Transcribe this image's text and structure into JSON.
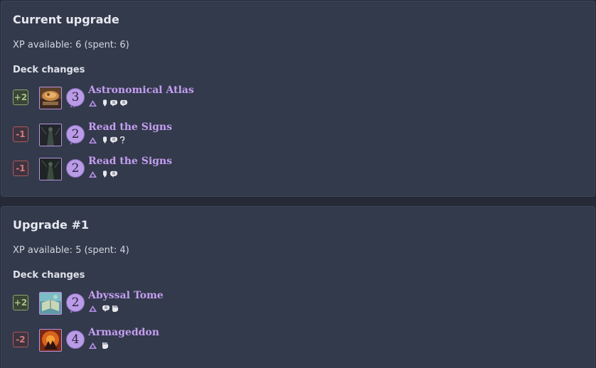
{
  "upgrades": [
    {
      "title": "Current upgrade",
      "xp_text": "XP available: 6 (spent: 6)",
      "section_label": "Deck changes",
      "cards": [
        {
          "qty": "+2",
          "kind": "add",
          "level": "3",
          "name": "Astronomical Atlas",
          "icons": [
            "mystic-class-icon",
            "willpower-skill-icon",
            "intellect-skill-icon",
            "intellect-skill-icon"
          ],
          "thumb": "atlas"
        },
        {
          "qty": "-1",
          "kind": "remove",
          "level": "2",
          "name": "Read the Signs",
          "icons": [
            "mystic-class-icon",
            "willpower-skill-icon",
            "intellect-skill-icon",
            "wild-skill-icon"
          ],
          "thumb": "signs"
        },
        {
          "qty": "-1",
          "kind": "remove",
          "level": "2",
          "name": "Read the Signs",
          "icons": [
            "mystic-class-icon",
            "willpower-skill-icon",
            "intellect-skill-icon"
          ],
          "thumb": "signs"
        }
      ]
    },
    {
      "title": "Upgrade #1",
      "xp_text": "XP available: 5 (spent: 4)",
      "section_label": "Deck changes",
      "cards": [
        {
          "qty": "+2",
          "kind": "add",
          "level": "2",
          "name": "Abyssal Tome",
          "icons": [
            "mystic-class-icon",
            "intellect-skill-icon",
            "combat-skill-icon"
          ],
          "thumb": "tome"
        },
        {
          "qty": "-2",
          "kind": "remove",
          "level": "4",
          "name": "Armageddon",
          "icons": [
            "mystic-class-icon",
            "combat-skill-icon"
          ],
          "thumb": "armageddon"
        }
      ]
    }
  ],
  "colors": {
    "card_name": "#c49ef2",
    "add": "#a9c384",
    "remove": "#d57a7e",
    "panel": "#333a4b",
    "background": "#252a36"
  }
}
